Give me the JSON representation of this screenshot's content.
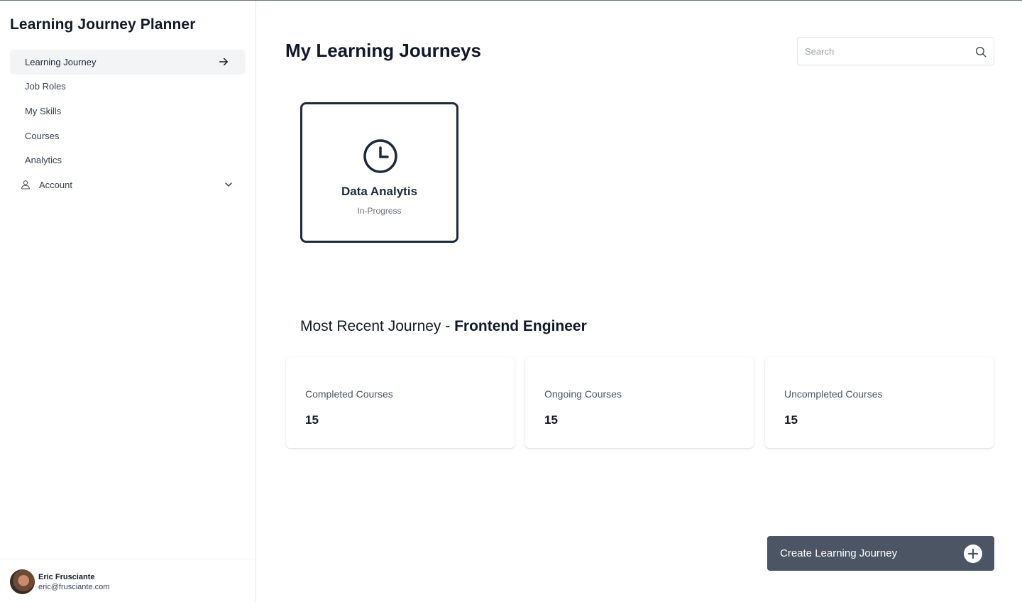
{
  "app": {
    "title": "Learning Journey Planner"
  },
  "sidebar": {
    "items": [
      {
        "label": "Learning Journey",
        "icon": "arrow-right-icon",
        "active": true
      },
      {
        "label": "Job Roles"
      },
      {
        "label": "My Skills"
      },
      {
        "label": "Courses"
      },
      {
        "label": "Analytics"
      },
      {
        "label": "Account",
        "icon": "user-icon",
        "trailing_icon": "chevron-down-icon"
      }
    ]
  },
  "profile": {
    "name": "Eric Frusciante",
    "email": "eric@frusciante.com"
  },
  "header": {
    "title": "My Learning Journeys"
  },
  "search": {
    "placeholder": "Search",
    "value": ""
  },
  "journeys": [
    {
      "title": "Data Analytis",
      "status": "In-Progress",
      "icon": "clock-icon"
    }
  ],
  "recent": {
    "prefix": "Most Recent Journey - ",
    "role": "Frontend Engineer"
  },
  "stats": [
    {
      "label": "Completed Courses",
      "value": "15"
    },
    {
      "label": "Ongoing Courses",
      "value": "15"
    },
    {
      "label": "Uncompleted Courses",
      "value": "15"
    }
  ],
  "actions": {
    "create_label": "Create Learning Journey",
    "create_icon": "plus-circle-icon"
  },
  "colors": {
    "sidebar_active_bg": "#f3f4f6",
    "button_bg": "#4b5563",
    "card_border": "#1f2937"
  }
}
